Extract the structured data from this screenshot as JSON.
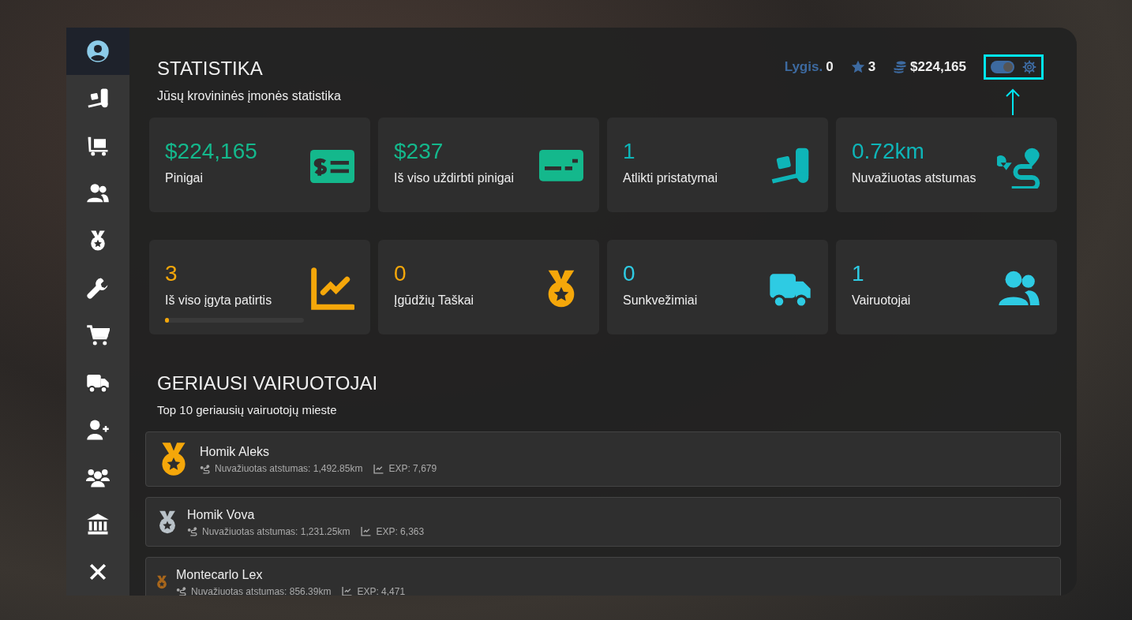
{
  "sidebar": {
    "items": [
      {
        "kind": "user",
        "selected": true
      },
      {
        "kind": "dolly",
        "selected": false
      },
      {
        "kind": "cart-box",
        "selected": false
      },
      {
        "kind": "users",
        "selected": false
      },
      {
        "kind": "medal",
        "selected": false
      },
      {
        "kind": "wrench",
        "selected": false
      },
      {
        "kind": "cart",
        "selected": false
      },
      {
        "kind": "truck",
        "selected": false
      },
      {
        "kind": "user-plus",
        "selected": false
      },
      {
        "kind": "group",
        "selected": false
      },
      {
        "kind": "bank",
        "selected": false
      },
      {
        "kind": "close",
        "selected": false
      }
    ]
  },
  "header": {
    "title": "STATISTIKA",
    "subtitle": "Jūsų krovininės įmonės statistika",
    "level_label": "Lygis.",
    "level_value": "0",
    "stars_value": "3",
    "money": "$224,165",
    "toggle_on": true
  },
  "stats": [
    {
      "value": "$224,165",
      "label": "Pinigai",
      "kind": "money",
      "color": "#14b88c"
    },
    {
      "value": "$237",
      "label": "Iš viso uždirbti pinigai",
      "kind": "card",
      "color": "#14b88c"
    },
    {
      "value": "1",
      "label": "Atlikti pristatymai",
      "kind": "dolly",
      "color": "#0eb5b8"
    },
    {
      "value": "0.72km",
      "label": "Nuvažiuotas atstumas",
      "kind": "route",
      "color": "#0eb5b8"
    },
    {
      "value": "3",
      "label": "Iš viso įgyta patirtis",
      "kind": "chart",
      "color": "#f5a70a",
      "level": 0.03
    },
    {
      "value": "0",
      "label": "Įgūdžių Taškai",
      "kind": "medal",
      "color": "#f5a70a"
    },
    {
      "value": "0",
      "label": "Sunkvežimiai",
      "kind": "truck",
      "color": "#2ecbe3"
    },
    {
      "value": "1",
      "label": "Vairuotojai",
      "kind": "users",
      "color": "#2ecbe3"
    }
  ],
  "leaderboard": {
    "title": "GERIAUSI VAIRUOTOJAI",
    "subtitle": "Top 10 geriausių vairuotojų mieste",
    "drivers": [
      {
        "kind": "gold",
        "name": "Homik Aleks",
        "distance": "Nuvažiuotas atstumas: 1,492.85km",
        "exp": "EXP: 7,679"
      },
      {
        "kind": "silver",
        "name": "Homik Vova",
        "distance": "Nuvažiuotas atstumas: 1,231.25km",
        "exp": "EXP: 6,363"
      },
      {
        "kind": "bronze",
        "name": "Montecarlo Lex",
        "distance": "Nuvažiuotas atstumas: 856.39km",
        "exp": "EXP: 4,471"
      }
    ]
  }
}
